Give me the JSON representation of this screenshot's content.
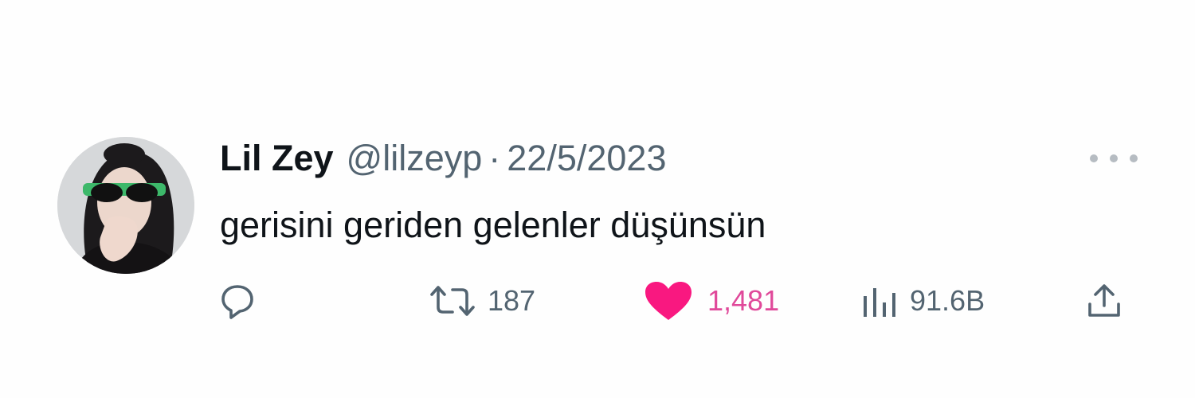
{
  "tweet": {
    "display_name": "Lil Zey",
    "handle": "@lilzeyp",
    "separator": "·",
    "date": "22/5/2023",
    "text": "gerisini geriden gelenler düşünsün",
    "avatar_icon": "profile-photo",
    "more_icon": "more-dots-icon"
  },
  "actions": {
    "reply": {
      "icon": "reply-bubble-icon"
    },
    "retweet": {
      "icon": "retweet-icon",
      "count": "187"
    },
    "like": {
      "icon": "heart-icon",
      "count": "1,481",
      "liked": true,
      "color": "#f91880"
    },
    "views": {
      "icon": "views-bar-chart-icon",
      "count": "91.6B"
    },
    "share": {
      "icon": "share-upload-icon"
    }
  },
  "colors": {
    "background": "#fefefe",
    "text_primary": "#0f1419",
    "text_secondary": "#536471",
    "like_accent": "#f91880"
  }
}
